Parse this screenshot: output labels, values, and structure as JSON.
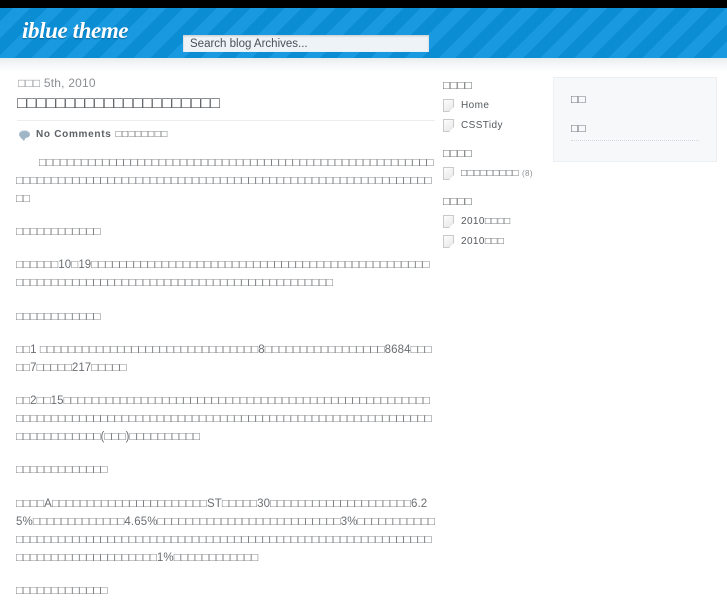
{
  "site": {
    "logo": "iblue theme",
    "search_placeholder": "Search blog Archives...",
    "search_value": ""
  },
  "post": {
    "date": "□□□ 5th, 2010",
    "title": "□□□□□□□□□□□□□□□□□□□□□",
    "comments_label": "No Comments",
    "comments_tofu": "□□□□□□□□",
    "paragraphs": [
      "□□□□□□□□□□□□□□□□□□□□□□□□□□□□□□□□□□□□□□□□□□□□□□□□□□□□□□□□□□□□□□□□□□□□□□□□□□□□□□□□□□□□□□□□□□□□□□□□□□□□□□□□□□□□□□□□□□□□□",
      "□□□□□□□□□□□□",
      "□□□□□□10□19□□□□□□□□□□□□□□□□□□□□□□□□□□□□□□□□□□□□□□□□□□□□□□□□□□□□□□□□□□□□□□□□□□□□□□□□□□□□□□□□□□□□□□□□□□□□□",
      "□□□□□□□□□□□□",
      "□□1 □□□□□□□□□□□□□□□□□□□□□□□□□□□□□□□8□□□□□□□□□□□□□□□□□8684□□□□□7□□□□□217□□□□□",
      "□□2□□15□□□□□□□□□□□□□□□□□□□□□□□□□□□□□□□□□□□□□□□□□□□□□□□□□□□□□□□□□□□□□□□□□□□□□□□□□□□□□□□□□□□□□□□□□□□□□□□□□□□□□□□□□□□□□□□□□□□□□□□□□□□(□□□)□□□□□□□□□□",
      "□□□□□□□□□□□□□",
      "□□□□A□□□□□□□□□□□□□□□□□□□□□□ST□□□□□30□□□□□□□□□□□□□□□□□□□□6.25%□□□□□□□□□□□□□4.65%□□□□□□□□□□□□□□□□□□□□□□□□□□3%□□□□□□□□□□□□□□□□□□□□□□□□□□□□□□□□□□□□□□□□□□□□□□□□□□□□□□□□□□□□□□□□□□□□□□□□□□□□□□□□□□□□□□□□□□1%□□□□□□□□□□□□",
      "□□□□□□□□□□□□□"
    ]
  },
  "sidebar": {
    "widgets": [
      {
        "title": "□□□□",
        "items": [
          {
            "label": "Home",
            "count": ""
          },
          {
            "label": "CSSTidy",
            "count": ""
          }
        ]
      },
      {
        "title": "□□□□",
        "items": [
          {
            "label": "□□□□□□□□□",
            "count": "(8)"
          }
        ]
      },
      {
        "title": "□□□□",
        "items": [
          {
            "label": "2010□□□□",
            "count": ""
          },
          {
            "label": "2010□□□",
            "count": ""
          }
        ]
      }
    ]
  },
  "sidebar_secondary": {
    "items": [
      {
        "label": "□□",
        "dotted": false
      },
      {
        "label": "□□",
        "dotted": true
      }
    ]
  }
}
